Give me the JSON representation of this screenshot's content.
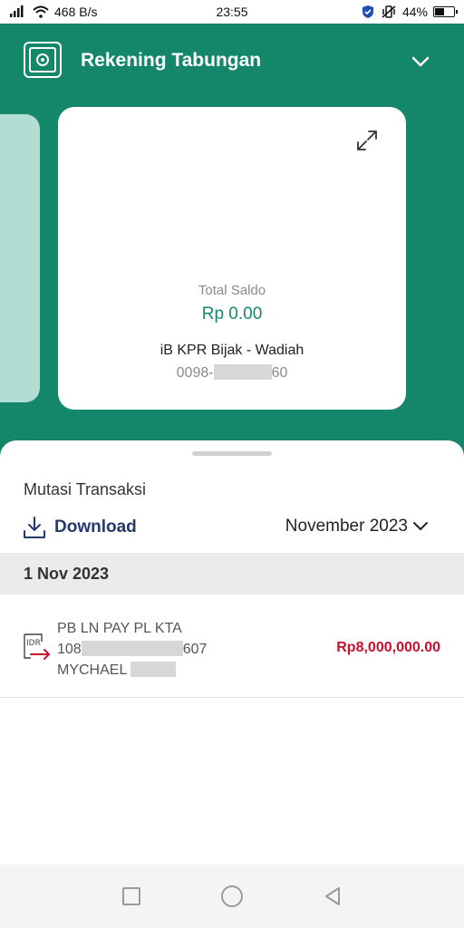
{
  "status_bar": {
    "network_speed": "468 B/s",
    "time": "23:55",
    "battery": "44%"
  },
  "header": {
    "title": "Rekening Tabungan",
    "icon": "safe-icon",
    "dropdown_icon": "chevron-down-icon"
  },
  "account_card": {
    "balance_label": "Total Saldo",
    "balance": "Rp 0.00",
    "product_name": "iB KPR Bijak - Wadiah",
    "account_prefix": "0098-",
    "account_suffix": "60",
    "expand_icon": "expand-icon"
  },
  "transactions": {
    "section_title": "Mutasi Transaksi",
    "download_label": "Download",
    "month_selected": "November 2023",
    "groups": [
      {
        "date": "1 Nov 2023",
        "items": [
          {
            "currency_icon_text": "IDR",
            "description": "PB LN PAY PL KTA",
            "ref_prefix": "108",
            "ref_suffix": "607",
            "name": "MYCHAEL",
            "amount": "Rp8,000,000.00"
          }
        ]
      }
    ]
  },
  "colors": {
    "brand_green": "#14876b",
    "amount_red": "#c8102e",
    "download_blue": "#243a6b"
  }
}
